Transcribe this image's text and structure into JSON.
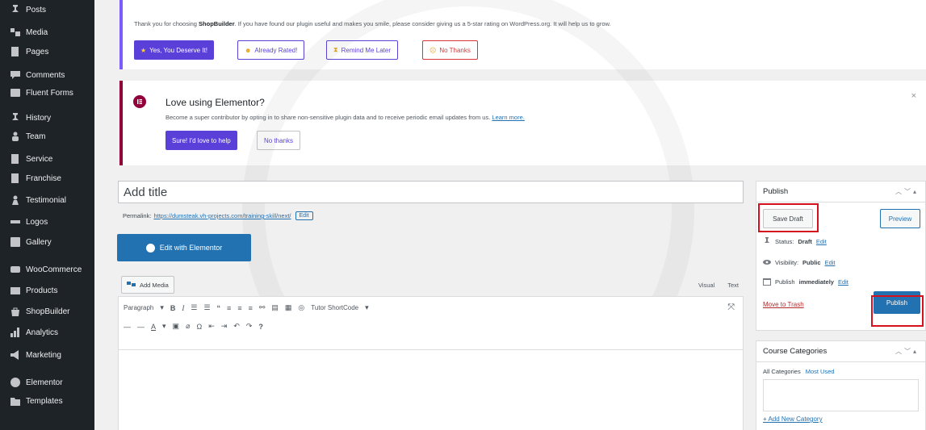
{
  "sidebar": {
    "items": [
      {
        "label": "Posts",
        "icon": "pin-icon"
      },
      {
        "label": "Media",
        "icon": "media-icon"
      },
      {
        "label": "Pages",
        "icon": "pages-icon"
      },
      {
        "label": "Comments",
        "icon": "comments-icon"
      },
      {
        "label": "Fluent Forms",
        "icon": "forms-icon"
      },
      {
        "label": "History",
        "icon": "pin-icon"
      },
      {
        "label": "Team",
        "icon": "team-icon"
      },
      {
        "label": "Service",
        "icon": "pages-icon"
      },
      {
        "label": "Franchise",
        "icon": "pages-icon"
      },
      {
        "label": "Testimonial",
        "icon": "person-icon"
      },
      {
        "label": "Logos",
        "icon": "logos-icon"
      },
      {
        "label": "Gallery",
        "icon": "gallery-icon"
      },
      {
        "label": "WooCommerce",
        "icon": "woo-icon"
      },
      {
        "label": "Products",
        "icon": "products-icon"
      },
      {
        "label": "ShopBuilder",
        "icon": "shop-icon"
      },
      {
        "label": "Analytics",
        "icon": "analytics-icon"
      },
      {
        "label": "Marketing",
        "icon": "marketing-icon"
      },
      {
        "label": "Elementor",
        "icon": "elementor-icon"
      },
      {
        "label": "Templates",
        "icon": "templates-icon"
      }
    ]
  },
  "shopbuilder_notice": {
    "text_before": "Thank you for choosing ",
    "brand": "ShopBuilder",
    "text_after": ". If you have found our plugin useful and makes you smile, please consider giving us a 5-star rating on WordPress.org. It will help us to grow.",
    "buttons": {
      "yes": "Yes, You Deserve It!",
      "rated": "Already Rated!",
      "later": "Remind Me Later",
      "no": "No Thanks"
    }
  },
  "elementor_notice": {
    "title": "Love using Elementor?",
    "text": "Become a super contributor by opting in to share non-sensitive plugin data and to receive periodic email updates from us.",
    "link": "Learn more.",
    "primary_button": "Sure! I'd love to help",
    "secondary_button": "No thanks",
    "close": "×"
  },
  "editor": {
    "title_placeholder": "Add title",
    "permalink_label": "Permalink:",
    "permalink_url": "https://dumsteak.vh-projects.com/training-skill/next/",
    "permalink_edit": "Edit",
    "elementor_button": "Edit with Elementor",
    "add_media": "Add Media",
    "tab_visual": "Visual",
    "tab_text": "Text",
    "format_select": "Paragraph",
    "tutor_shortcode": "Tutor ShortCode"
  },
  "publish_panel": {
    "title": "Publish",
    "save_draft": "Save Draft",
    "preview": "Preview",
    "status_label": "Status:",
    "status_value": "Draft",
    "visibility_label": "Visibility:",
    "visibility_value": "Public",
    "publish_label": "Publish",
    "publish_value": "immediately",
    "edit": "Edit",
    "move_to_trash": "Move to Trash",
    "publish_button": "Publish"
  },
  "course_categories_panel": {
    "title": "Course Categories",
    "tab_all": "All Categories",
    "tab_most_used": "Most Used",
    "add_new": "+ Add New Category"
  },
  "colors": {
    "sidebar_bg": "#1d2327",
    "primary": "#2271b1",
    "highlight_box": "#d6111e",
    "elementor": "#92003b",
    "shopbuilder": "#7c5cfa"
  }
}
